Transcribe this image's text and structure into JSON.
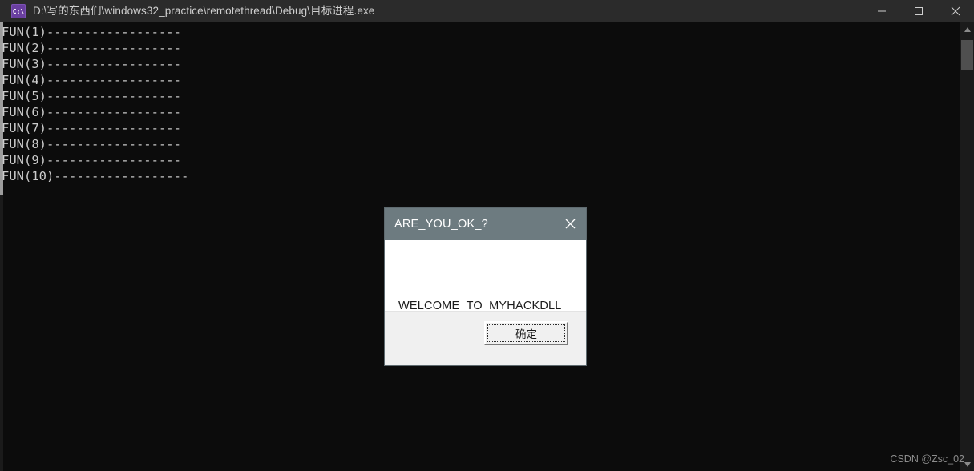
{
  "window": {
    "title": "D:\\写的东西们\\windows32_practice\\remotethread\\Debug\\目标进程.exe",
    "icon_name": "console-app-icon",
    "icon_glyph": "C:\\",
    "titlebar_color": "#2b2b2b",
    "controls": {
      "minimize_label": "Minimize",
      "maximize_label": "Maximize",
      "close_label": "Close"
    }
  },
  "console": {
    "background_color": "#0c0c0c",
    "text_color": "#cccccc",
    "lines": [
      "FUN(1)------------------",
      "FUN(2)------------------",
      "FUN(3)------------------",
      "FUN(4)------------------",
      "FUN(5)------------------",
      "FUN(6)------------------",
      "FUN(7)------------------",
      "FUN(8)------------------",
      "FUN(9)------------------",
      "FUN(10)------------------"
    ],
    "output": "FUN(1)------------------\nFUN(2)------------------\nFUN(3)------------------\nFUN(4)------------------\nFUN(5)------------------\nFUN(6)------------------\nFUN(7)------------------\nFUN(8)------------------\nFUN(9)------------------\nFUN(10)------------------"
  },
  "dialog": {
    "title": "ARE_YOU_OK_?",
    "message": "WELCOME_TO_MYHACKDLL",
    "ok_button_label": "确定",
    "close_label": "Close",
    "titlebar_color": "#6d7b80",
    "body_color": "#ffffff",
    "footer_color": "#f0f0f0"
  },
  "watermark": {
    "text": "CSDN @Zsc_02"
  }
}
